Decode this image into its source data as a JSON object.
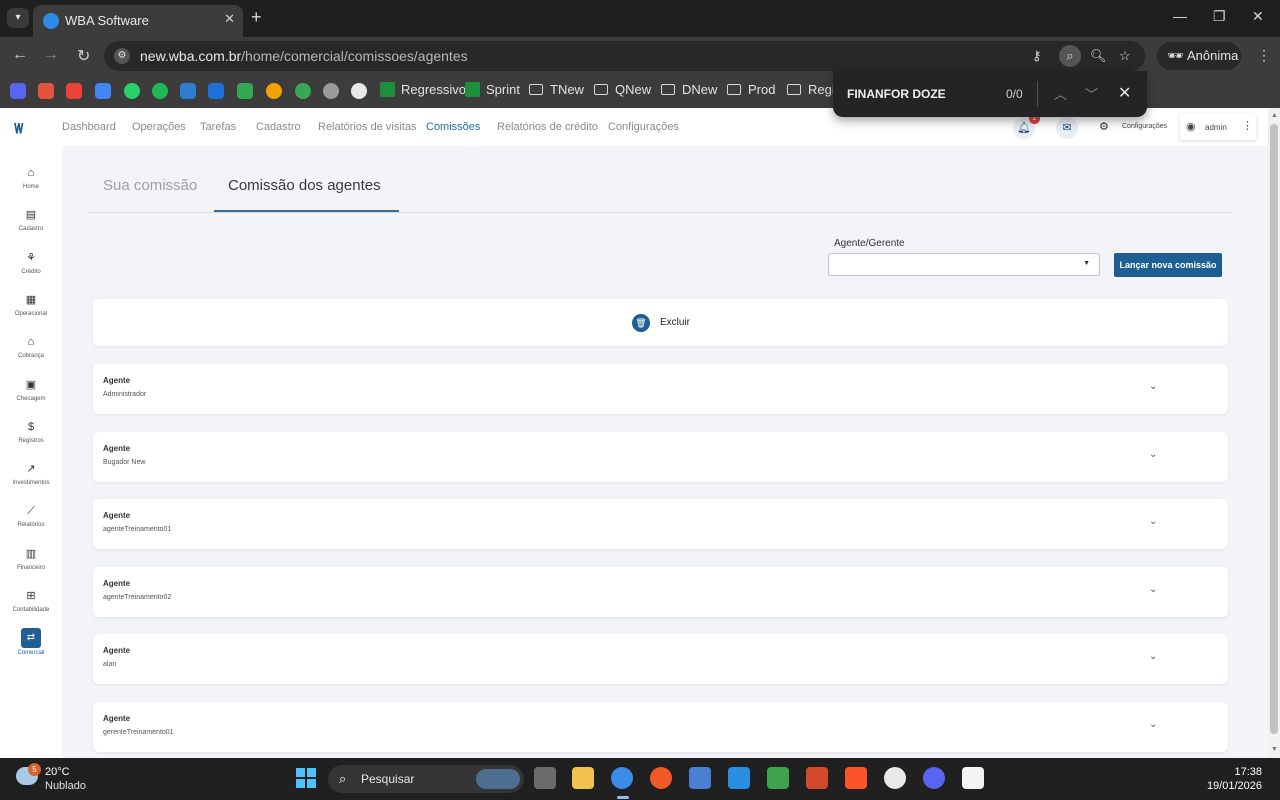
{
  "browser": {
    "tab_title": "WBA Software",
    "url_host": "new.wba.com.br",
    "url_path": "/home/comercial/comissoes/agentes",
    "profile_label": "Anônima",
    "bookmarks": [
      {
        "label": "Regressivo"
      },
      {
        "label": "Sprint"
      },
      {
        "label": "TNew"
      },
      {
        "label": "QNew"
      },
      {
        "label": "DNew"
      },
      {
        "label": "Prod"
      },
      {
        "label": "Regis"
      }
    ]
  },
  "find_bar": {
    "query": "FINANFOR DOZE",
    "count": "0/0"
  },
  "topnav": {
    "items": [
      {
        "label": "Dashboard"
      },
      {
        "label": "Operações"
      },
      {
        "label": "Tarefas"
      },
      {
        "label": "Cadastro"
      },
      {
        "label": "Relatórios de visitas"
      },
      {
        "label": "Comissões"
      },
      {
        "label": "Relatórios de crédito"
      },
      {
        "label": "Configurações"
      }
    ],
    "notification_count": "2",
    "settings_label": "Configurações",
    "user_label": "admin"
  },
  "sidebar": {
    "items": [
      {
        "label": "Home"
      },
      {
        "label": "Cadastro"
      },
      {
        "label": "Crédito"
      },
      {
        "label": "Operacional"
      },
      {
        "label": "Cobrança"
      },
      {
        "label": "Checagem"
      },
      {
        "label": "Registros"
      },
      {
        "label": "Investimentos"
      },
      {
        "label": "Relatórios"
      },
      {
        "label": "Financeiro"
      },
      {
        "label": "Contabilidade"
      },
      {
        "label": "Comercial"
      }
    ]
  },
  "page": {
    "tabs": [
      {
        "label": "Sua comissão"
      },
      {
        "label": "Comissão dos agentes"
      }
    ],
    "filter_label": "Agente/Gerente",
    "filter_value": "",
    "new_commission_button": "Lançar nova comissão",
    "delete_label": "Excluir",
    "agent_field_label": "Agente",
    "agents": [
      {
        "name": "Administrador"
      },
      {
        "name": "Bugador New"
      },
      {
        "name": "agenteTreinamento01"
      },
      {
        "name": "agenteTreinamento02"
      },
      {
        "name": "alan"
      },
      {
        "name": "gerenteTreinamento01"
      }
    ]
  },
  "taskbar": {
    "temperature": "20°C",
    "weather": "Nublado",
    "weather_badge": "5",
    "search_label": "Pesquisar",
    "time": "17:38",
    "date": "19/01/2026"
  },
  "colors": {
    "primary": "#1d5f95",
    "nav_active": "#1c6eb0",
    "page_bg": "#f2f4f7"
  }
}
